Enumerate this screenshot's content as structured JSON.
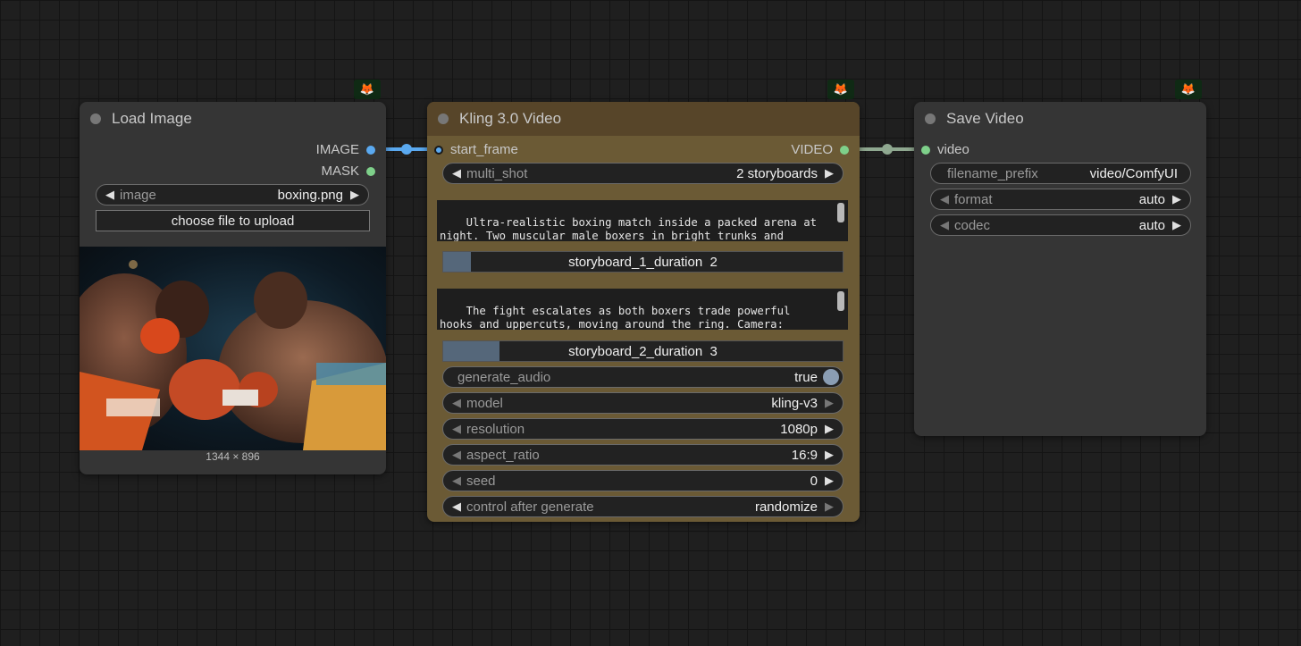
{
  "nodes": {
    "load_image": {
      "title": "Load Image",
      "outputs": [
        "IMAGE",
        "MASK"
      ],
      "image_widget": {
        "label": "image",
        "value": "boxing.png"
      },
      "upload_button": "choose file to upload",
      "preview_dims": "1344 × 896"
    },
    "kling": {
      "title": "Kling 3.0 Video",
      "input": "start_frame",
      "output": "VIDEO",
      "multi_shot": {
        "label": "multi_shot",
        "value": "2 storyboards"
      },
      "prompt1": "Ultra-realistic boxing match inside a packed arena at night. Two muscular male boxers in bright trunks and gloves exchange fast punches at close range, sweat flying off",
      "storyboard1": {
        "label": "storyboard_1_duration",
        "value": "2",
        "fraction": 0.07
      },
      "prompt2": "The fight escalates as both boxers trade powerful hooks and uppercuts, moving around the ring. Camera: begins with a medium shot showing both fighters from the waist up, then",
      "storyboard2": {
        "label": "storyboard_2_duration",
        "value": "3",
        "fraction": 0.14
      },
      "generate_audio": {
        "label": "generate_audio",
        "value": "true"
      },
      "model": {
        "label": "model",
        "value": "kling-v3"
      },
      "resolution": {
        "label": "resolution",
        "value": "1080p"
      },
      "aspect_ratio": {
        "label": "aspect_ratio",
        "value": "16:9"
      },
      "seed": {
        "label": "seed",
        "value": "0"
      },
      "control_after_generate": {
        "label": "control after generate",
        "value": "randomize"
      }
    },
    "save_video": {
      "title": "Save Video",
      "input": "video",
      "filename_prefix": {
        "label": "filename_prefix",
        "value": "video/ComfyUI"
      },
      "format": {
        "label": "format",
        "value": "auto"
      },
      "codec": {
        "label": "codec",
        "value": "auto"
      }
    }
  },
  "colors": {
    "image_link": "#5aa9f0",
    "video_link": "#8fa890",
    "mask_slot": "#7ed08a",
    "kling_header": "#574529",
    "kling_body": "#6b5a35"
  },
  "icons": {
    "node_badge": "fox-icon"
  }
}
